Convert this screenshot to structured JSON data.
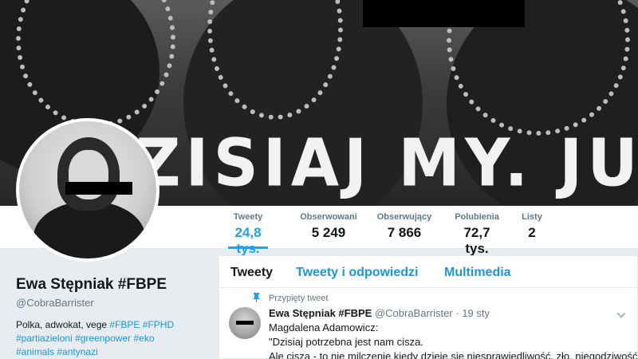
{
  "banner": {
    "slogan": "ZISIAJ MY. JUTRO"
  },
  "nav": {
    "stats": [
      {
        "label": "Tweety",
        "value": "24,8 tys."
      },
      {
        "label": "Obserwowani",
        "value": "5 249"
      },
      {
        "label": "Obserwujący",
        "value": "7 866"
      },
      {
        "label": "Polubienia",
        "value": "72,7 tys."
      },
      {
        "label": "Listy",
        "value": "2"
      }
    ],
    "active_index": 0
  },
  "profile": {
    "name": "Ewa Stępniak #FBPE",
    "handle": "@CobraBarrister",
    "bio_text": "Polka, adwokat, vege",
    "bio_tags_line1": [
      "#FBPE",
      "#FPHD"
    ],
    "bio_tags_line2": [
      "#partiazieloni",
      "#greenpower",
      "#eko"
    ],
    "bio_tags_line3": [
      "#animals",
      "#antynazi"
    ]
  },
  "timeline": {
    "tabs": [
      "Tweety",
      "Tweety i odpowiedzi",
      "Multimedia"
    ],
    "pinned_label": "Przypięty tweet",
    "tweet": {
      "author_name": "Ewa Stępniak #FBPE",
      "author_handle": "@CobraBarrister",
      "separator": "·",
      "date": "19 sty",
      "lines": [
        "Magdalena Adamowicz:",
        "\"Dzisiaj potrzebna jest nam cisza.",
        "Ale cisza - to nie milczenie kiedy dzieje się niesprawiedliwość, zło, niegodziwość\""
      ]
    }
  },
  "colors": {
    "accent": "#1da1f2",
    "link": "#1b95e0",
    "muted": "#657786",
    "background": "#e6ecf0"
  },
  "icons": [
    "pin-icon",
    "chevron-down-icon"
  ]
}
